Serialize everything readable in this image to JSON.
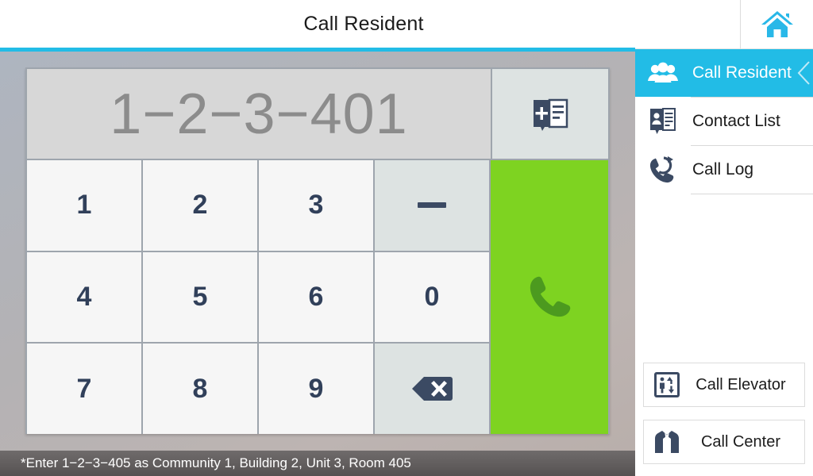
{
  "header": {
    "title": "Call Resident",
    "home_icon": "home-icon"
  },
  "dialer": {
    "display_value": "1−2−3−401",
    "add_contact_icon": "add-contact-book-icon",
    "keys": [
      {
        "label": "1",
        "type": "digit",
        "name": "key-1"
      },
      {
        "label": "2",
        "type": "digit",
        "name": "key-2"
      },
      {
        "label": "3",
        "type": "digit",
        "name": "key-3"
      },
      {
        "label": "−",
        "type": "dash",
        "name": "key-dash"
      },
      {
        "label": "4",
        "type": "digit",
        "name": "key-4"
      },
      {
        "label": "5",
        "type": "digit",
        "name": "key-5"
      },
      {
        "label": "6",
        "type": "digit",
        "name": "key-6"
      },
      {
        "label": "0",
        "type": "digit",
        "name": "key-0"
      },
      {
        "label": "7",
        "type": "digit",
        "name": "key-7"
      },
      {
        "label": "8",
        "type": "digit",
        "name": "key-8"
      },
      {
        "label": "9",
        "type": "digit",
        "name": "key-9"
      },
      {
        "label": "",
        "type": "backspace",
        "name": "key-backspace"
      }
    ],
    "call_button_icon": "phone-handset-icon",
    "hint": "*Enter 1−2−3−405 as Community 1, Building 2, Unit 3, Room 405"
  },
  "sidebar": {
    "items": [
      {
        "label": "Call Resident",
        "icon": "group-people-icon",
        "active": true
      },
      {
        "label": "Contact List",
        "icon": "contact-book-icon",
        "active": false
      },
      {
        "label": "Call Log",
        "icon": "phone-history-icon",
        "active": false
      }
    ],
    "actions": [
      {
        "label": "Call Elevator",
        "icon": "elevator-icon"
      },
      {
        "label": "Call Center",
        "icon": "suit-tie-icon"
      }
    ]
  },
  "colors": {
    "accent_cyan": "#22bce6",
    "call_green": "#7ed321",
    "icon_navy": "#3b4a63",
    "display_text": "#8c8c8c"
  }
}
